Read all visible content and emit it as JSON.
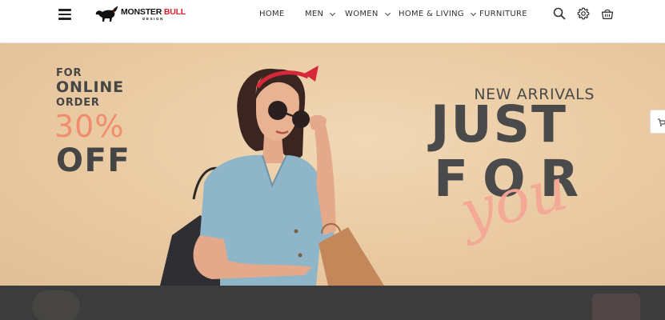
{
  "header": {
    "menu_icon": "hamburger-menu-icon",
    "logo": {
      "name_part1": "MONSTER",
      "name_part2": "BULL",
      "tagline": "DESIGN",
      "icon": "bull-logo-icon"
    },
    "nav": [
      {
        "label": "HOME",
        "has_dropdown": false
      },
      {
        "label": "MEN",
        "has_dropdown": true
      },
      {
        "label": "WOMEN",
        "has_dropdown": true
      },
      {
        "label": "HOME & LIVING",
        "has_dropdown": true
      },
      {
        "label": "FURNITURE",
        "has_dropdown": false
      }
    ],
    "icons": [
      "search-icon",
      "settings-gear-icon",
      "shopping-basket-icon"
    ]
  },
  "hero": {
    "promo": {
      "line1": "FOR",
      "line2": "ONLINE",
      "line3": "ORDER",
      "discount": "30%",
      "off": "OFF"
    },
    "headline": {
      "eyebrow": "NEW ARRIVALS",
      "word1": "JUST",
      "word2": "FOR",
      "script": "you"
    },
    "side_tab_icon": "cart-icon"
  },
  "colors": {
    "accent": "#f08d6c",
    "script": "#f5a896",
    "text_dark": "#454545",
    "brand_red": "#e01f26",
    "hero_bg": "#ebcda6",
    "band": "#3c3c3c"
  }
}
